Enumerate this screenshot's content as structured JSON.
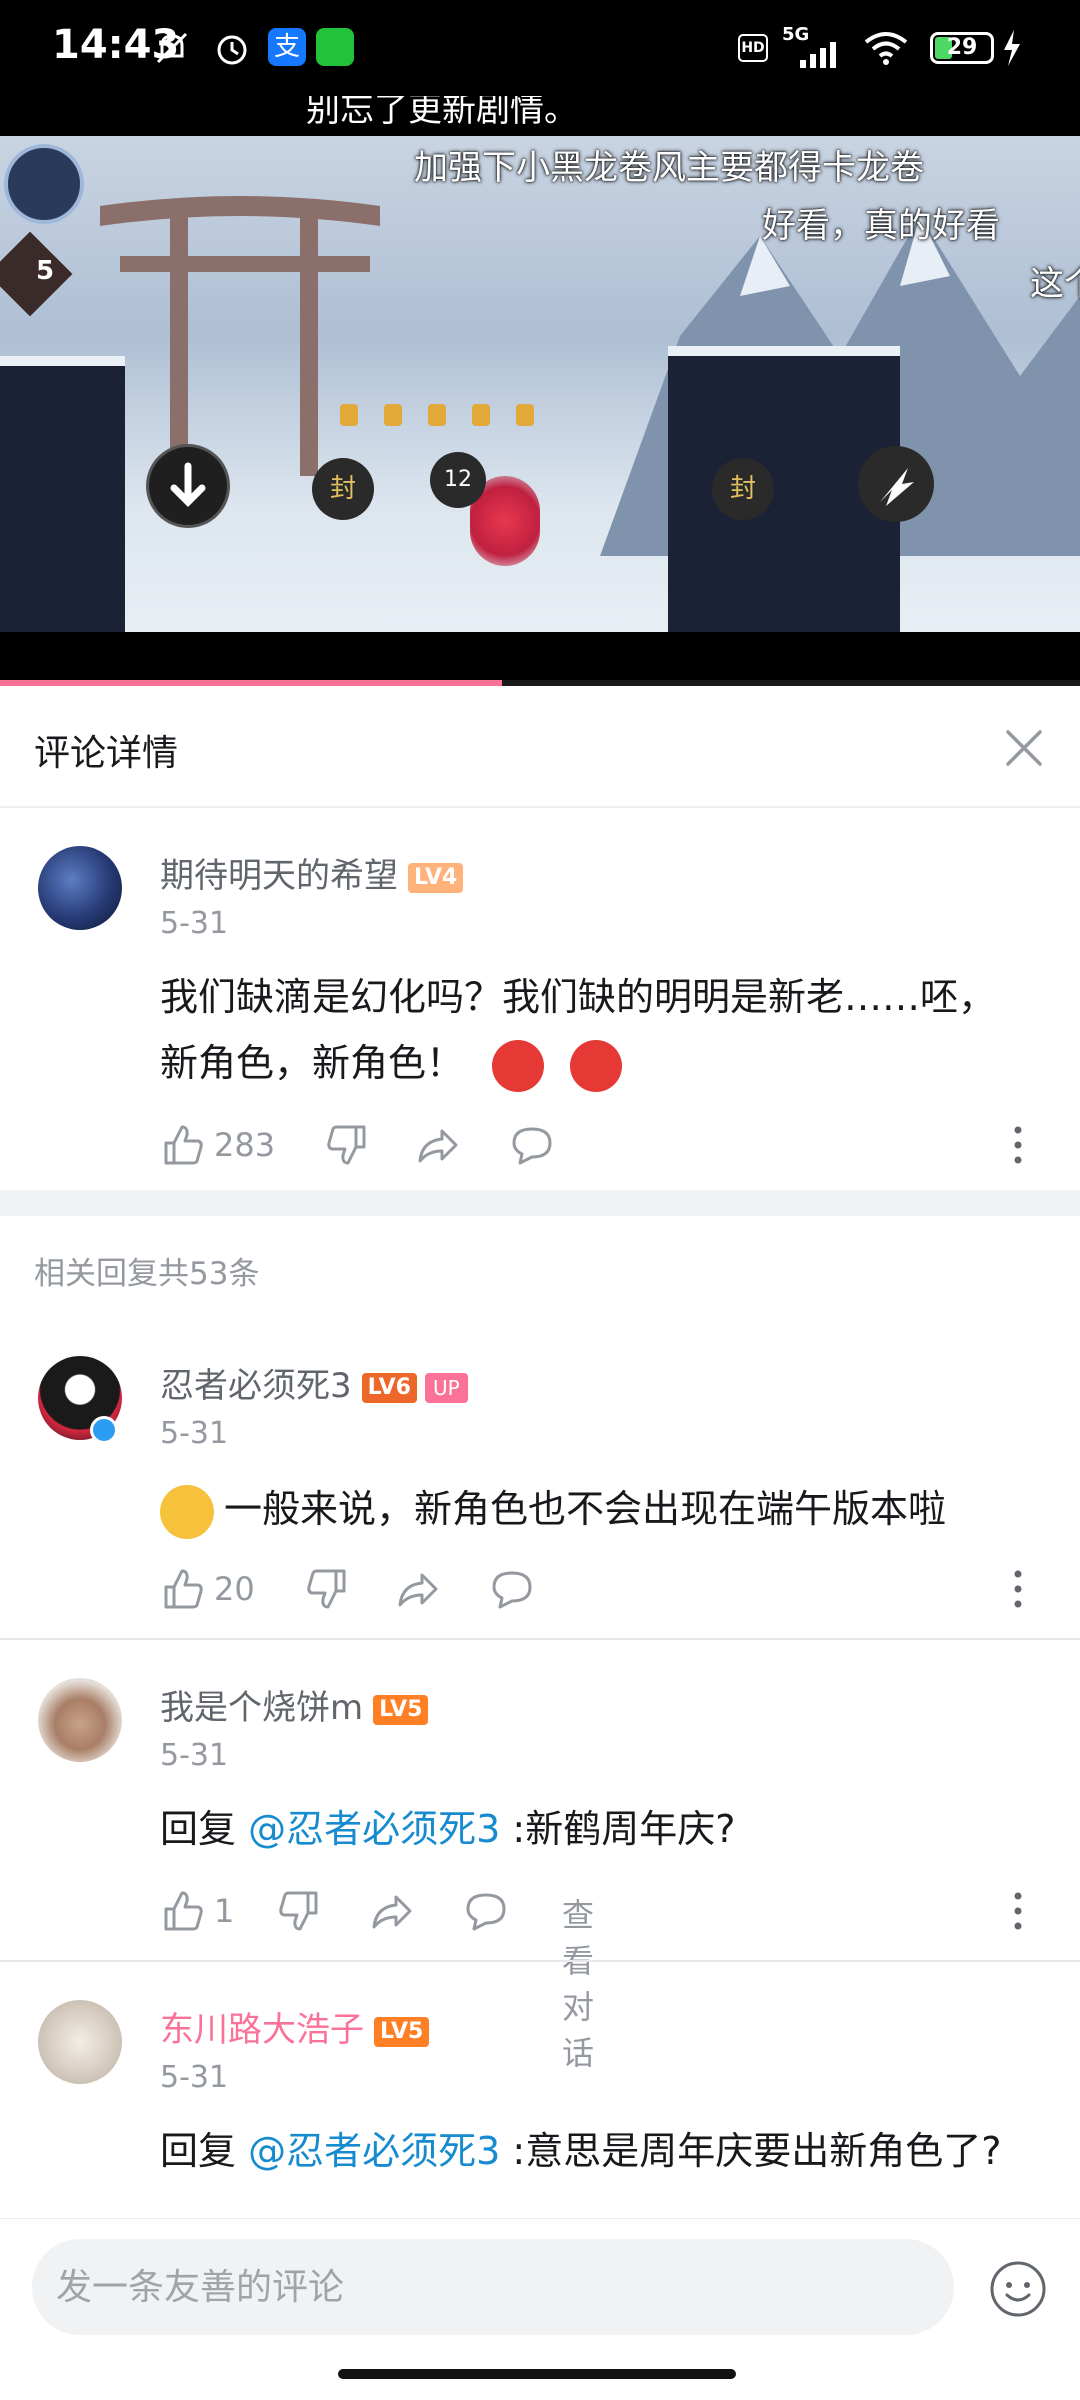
{
  "status_bar": {
    "time": "14:43",
    "network": "5G",
    "hd": "HD",
    "battery": "29",
    "icons": [
      "mute-icon",
      "alarm-icon",
      "alipay-icon",
      "wechat-icon",
      "signal-icon",
      "wifi-icon",
      "charging-icon"
    ]
  },
  "video": {
    "danmaku": [
      "别忘了更新剧情。",
      "加强下小黑龙卷风主要都得卡龙卷",
      "好看，真的好看",
      "这个"
    ],
    "hud": {
      "level_badge": "5",
      "skill_seal_1": "封",
      "combo_count": "12",
      "skill_seal_2": "封"
    },
    "progress": 0.465
  },
  "detail": {
    "title": "评论详情"
  },
  "root_comment": {
    "username": "期待明天的希望",
    "level": "LV4",
    "date": "5-31",
    "text": "我们缺滴是幻化吗？我们缺的明明是新老……呸，新角色，新角色！",
    "emoji": [
      "angry-emoji",
      "angry-emoji"
    ],
    "likes": "283"
  },
  "replies_header": "相关回复共53条",
  "replies": [
    {
      "username": "忍者必须死3",
      "level": "LV6",
      "badge": "UP",
      "date": "5-31",
      "prefix_emoji": "thinking-emoji",
      "text": "一般来说，新角色也不会出现在端午版本啦",
      "likes": "20"
    },
    {
      "username": "我是个烧饼m",
      "level": "LV5",
      "date": "5-31",
      "reply_label": "回复",
      "mention": "@忍者必须死3",
      "text": ":新鹤周年庆?",
      "likes": "1",
      "view_conversation": "查看对话"
    },
    {
      "username": "东川路大浩子",
      "level": "LV5",
      "date": "5-31",
      "reply_label": "回复",
      "mention": "@忍者必须死3",
      "text": ":意思是周年庆要出新角色了?"
    }
  ],
  "input": {
    "placeholder": "发一条友善的评论"
  },
  "colors": {
    "accent_pink": "#fb7299",
    "link_blue": "#178bcf",
    "lv4": "#ffb27a",
    "lv5": "#ff7f24",
    "lv6": "#ee672a"
  }
}
